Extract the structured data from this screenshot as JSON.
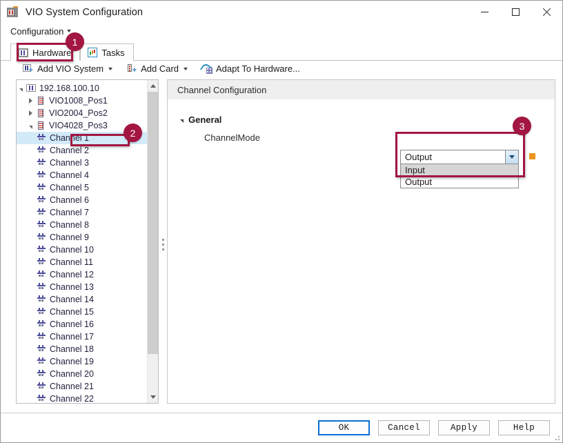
{
  "window": {
    "title": "VIO System Configuration",
    "icon": "vio-system-icon",
    "controls": {
      "minimize": "minimize-icon",
      "maximize": "maximize-icon",
      "close": "close-icon"
    }
  },
  "menu": {
    "configuration_label": "Configuration"
  },
  "tabs": [
    {
      "label": "Hardware",
      "icon": "hardware-icon",
      "selected": true
    },
    {
      "label": "Tasks",
      "icon": "tasks-icon",
      "selected": false
    }
  ],
  "toolbar": {
    "items": [
      {
        "label": "Add VIO System",
        "icon": "add-vio-system-icon",
        "has_caret": true
      },
      {
        "label": "Add Card",
        "icon": "add-card-icon",
        "has_caret": true
      },
      {
        "label": "Adapt To Hardware...",
        "icon": "adapt-to-hardware-icon",
        "has_caret": false
      }
    ]
  },
  "tree": {
    "root": {
      "label": "192.168.100.10",
      "expanded": true,
      "icon": "vio-system-icon"
    },
    "cards": [
      {
        "label": "VIO1008_Pos1",
        "expanded": false,
        "icon": "card-icon"
      },
      {
        "label": "VIO2004_Pos2",
        "expanded": false,
        "icon": "card-icon"
      },
      {
        "label": "VIO4028_Pos3",
        "expanded": true,
        "icon": "card-icon"
      }
    ],
    "channels": [
      {
        "label": "Channel 1",
        "selected": true
      },
      {
        "label": "Channel 2",
        "selected": false
      },
      {
        "label": "Channel 3",
        "selected": false
      },
      {
        "label": "Channel 4",
        "selected": false
      },
      {
        "label": "Channel 5",
        "selected": false
      },
      {
        "label": "Channel 6",
        "selected": false
      },
      {
        "label": "Channel 7",
        "selected": false
      },
      {
        "label": "Channel 8",
        "selected": false
      },
      {
        "label": "Channel 9",
        "selected": false
      },
      {
        "label": "Channel 10",
        "selected": false
      },
      {
        "label": "Channel 11",
        "selected": false
      },
      {
        "label": "Channel 12",
        "selected": false
      },
      {
        "label": "Channel 13",
        "selected": false
      },
      {
        "label": "Channel 14",
        "selected": false
      },
      {
        "label": "Channel 15",
        "selected": false
      },
      {
        "label": "Channel 16",
        "selected": false
      },
      {
        "label": "Channel 17",
        "selected": false
      },
      {
        "label": "Channel 18",
        "selected": false
      },
      {
        "label": "Channel 19",
        "selected": false
      },
      {
        "label": "Channel 20",
        "selected": false
      },
      {
        "label": "Channel 21",
        "selected": false
      },
      {
        "label": "Channel 22",
        "selected": false
      }
    ]
  },
  "panel": {
    "header": "Channel Configuration",
    "group": {
      "label": "General",
      "expanded": true
    },
    "property": {
      "name": "ChannelMode",
      "value": "Output",
      "options": [
        "Input",
        "Output"
      ],
      "highlighted_option": "Input"
    }
  },
  "footer": {
    "buttons": [
      {
        "label": "OK",
        "default": true
      },
      {
        "label": "Cancel",
        "default": false
      },
      {
        "label": "Apply",
        "default": false
      },
      {
        "label": "Help",
        "default": false
      }
    ]
  },
  "annotations": {
    "badges": [
      {
        "number": "1",
        "target": "hardware-tab"
      },
      {
        "number": "2",
        "target": "channel-1-tree-item"
      },
      {
        "number": "3",
        "target": "channelmode-combobox"
      }
    ],
    "accent_color": "#a31641"
  }
}
